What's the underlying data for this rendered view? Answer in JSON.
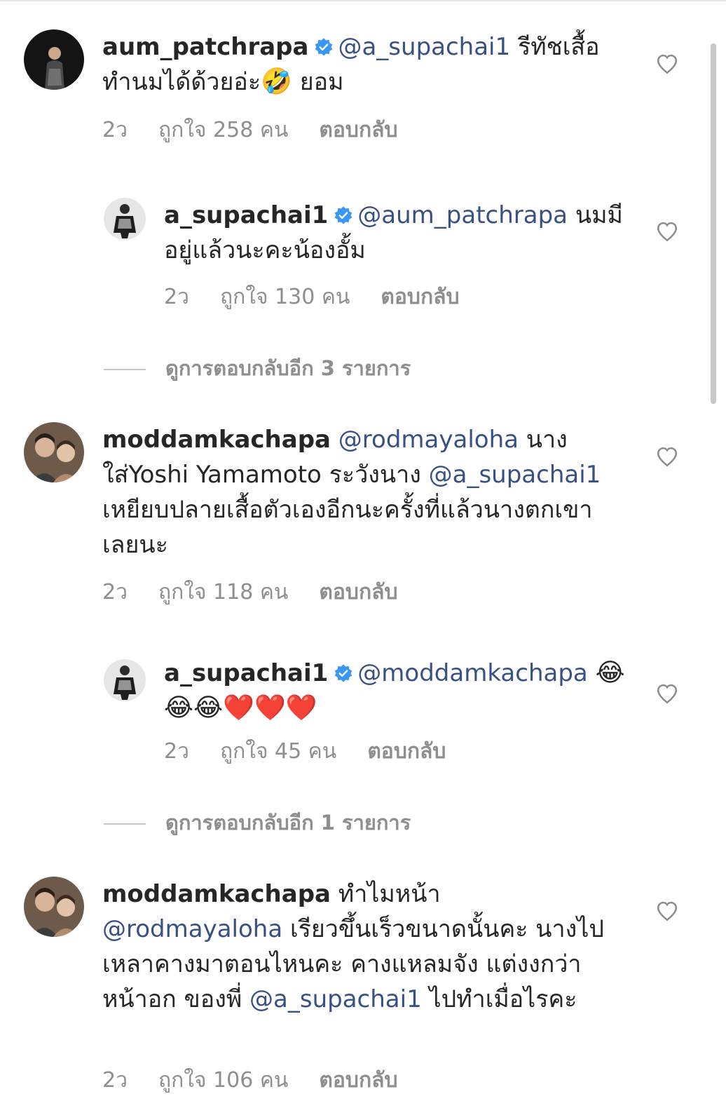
{
  "comments": [
    {
      "username": "aum_patchrapa",
      "verified": true,
      "parts": [
        {
          "t": "mention",
          "v": "@a_supachai1"
        },
        {
          "t": "text",
          "v": " รีทัชเสื้อทำนมได้ด้วยอ่ะ"
        },
        {
          "t": "emoji",
          "v": "🤣"
        },
        {
          "t": "text",
          "v": " ยอม"
        }
      ],
      "time": "2ว",
      "likes": "ถูกใจ 258 คน",
      "reply": "ตอบกลับ"
    },
    {
      "username": "a_supachai1",
      "verified": true,
      "parts": [
        {
          "t": "mention",
          "v": "@aum_patchrapa"
        },
        {
          "t": "text",
          "v": " นมมีอยู่แล้วนะคะน้องอั้ม"
        }
      ],
      "time": "2ว",
      "likes": "ถูกใจ 130 คน",
      "reply": "ตอบกลับ"
    },
    {
      "username": "moddamkachapa",
      "verified": false,
      "parts": [
        {
          "t": "mention",
          "v": "@rodmayaloha"
        },
        {
          "t": "text",
          "v": " นางใส่Yoshi Yamamoto ระวังนาง "
        },
        {
          "t": "mention",
          "v": "@a_supachai1"
        },
        {
          "t": "text",
          "v": " เหยียบปลายเสื้อตัวเองอีกนะครั้งที่แล้วนางตกเขาเลยนะ"
        }
      ],
      "time": "2ว",
      "likes": "ถูกใจ 118 คน",
      "reply": "ตอบกลับ"
    },
    {
      "username": "a_supachai1",
      "verified": true,
      "parts": [
        {
          "t": "mention",
          "v": "@moddamkachapa"
        },
        {
          "t": "text",
          "v": " "
        },
        {
          "t": "emoji",
          "v": "😂😂😂❤️❤️❤️"
        }
      ],
      "time": "2ว",
      "likes": "ถูกใจ 45 คน",
      "reply": "ตอบกลับ"
    },
    {
      "username": "moddamkachapa",
      "verified": false,
      "parts": [
        {
          "t": "text",
          "v": " ทำไมหน้า "
        },
        {
          "t": "mention",
          "v": "@rodmayaloha"
        },
        {
          "t": "text",
          "v": " เรียวขึ้นเร็วขนาดนั้นคะ นางไปเหลาคางมาตอนไหนคะ คางแหลมจัง แต่งงกว่า หน้าอก ของพี่ "
        },
        {
          "t": "mention",
          "v": "@a_supachai1"
        },
        {
          "t": "text",
          "v": " ไปทำเมื่อไรคะ"
        }
      ],
      "time": "2ว",
      "likes": "ถูกใจ 106 คน",
      "reply": "ตอบกลับ"
    }
  ],
  "view_replies": [
    "ดูการตอบกลับอีก 3 รายการ",
    "ดูการตอบกลับอีก 1 รายการ"
  ],
  "colors": {
    "mention": "#385185",
    "verified": "#3897f0",
    "meta": "#8e8e8e"
  },
  "icons": {
    "like": "heart-outline-icon",
    "verified": "verified-badge-icon"
  }
}
